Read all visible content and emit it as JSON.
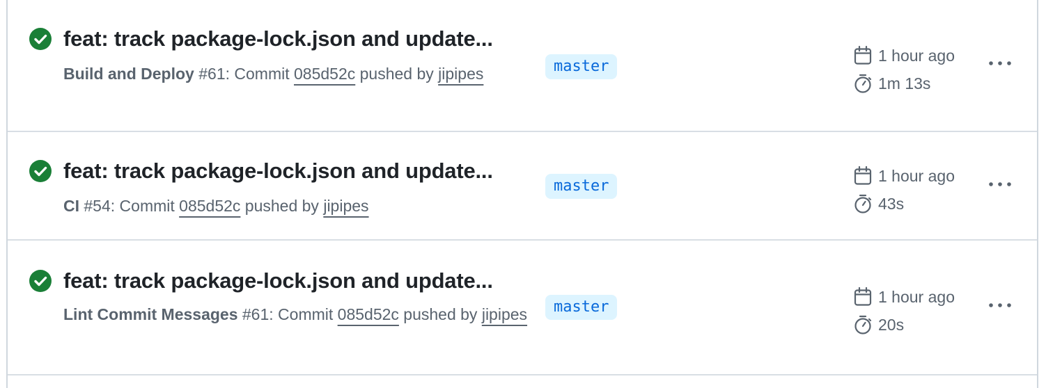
{
  "runs": [
    {
      "title": "feat: track package-lock.json and update...",
      "workflow": "Build and Deploy",
      "run_number": "#61",
      "commit_text": ": Commit ",
      "commit_sha": "085d52c",
      "pushed_by_text": " pushed by ",
      "author": "jipipes",
      "branch": "master",
      "time_ago": "1 hour ago",
      "duration": "1m 13s",
      "status": "success",
      "status_color": "#1a7f37"
    },
    {
      "title": "feat: track package-lock.json and update...",
      "workflow": "CI",
      "run_number": "#54",
      "commit_text": ": Commit ",
      "commit_sha": "085d52c",
      "pushed_by_text": " pushed by ",
      "author": "jipipes",
      "branch": "master",
      "time_ago": "1 hour ago",
      "duration": "43s",
      "status": "success",
      "status_color": "#1a7f37"
    },
    {
      "title": "feat: track package-lock.json and update...",
      "workflow": "Lint Commit Messages",
      "run_number": "#61",
      "commit_text": ": Commit ",
      "commit_sha": "085d52c",
      "pushed_by_text": " pushed by ",
      "author": "jipipes",
      "branch": "master",
      "time_ago": "1 hour ago",
      "duration": "20s",
      "status": "success",
      "status_color": "#1a7f37"
    }
  ],
  "icons": {
    "status": "check-circle-fill-icon",
    "date": "calendar-icon",
    "duration": "stopwatch-icon",
    "menu": "kebab-horizontal-icon"
  },
  "colors": {
    "success": "#1a7f37",
    "branch_bg": "#ddf4ff",
    "branch_text": "#0969da",
    "muted_text": "#59636e"
  }
}
